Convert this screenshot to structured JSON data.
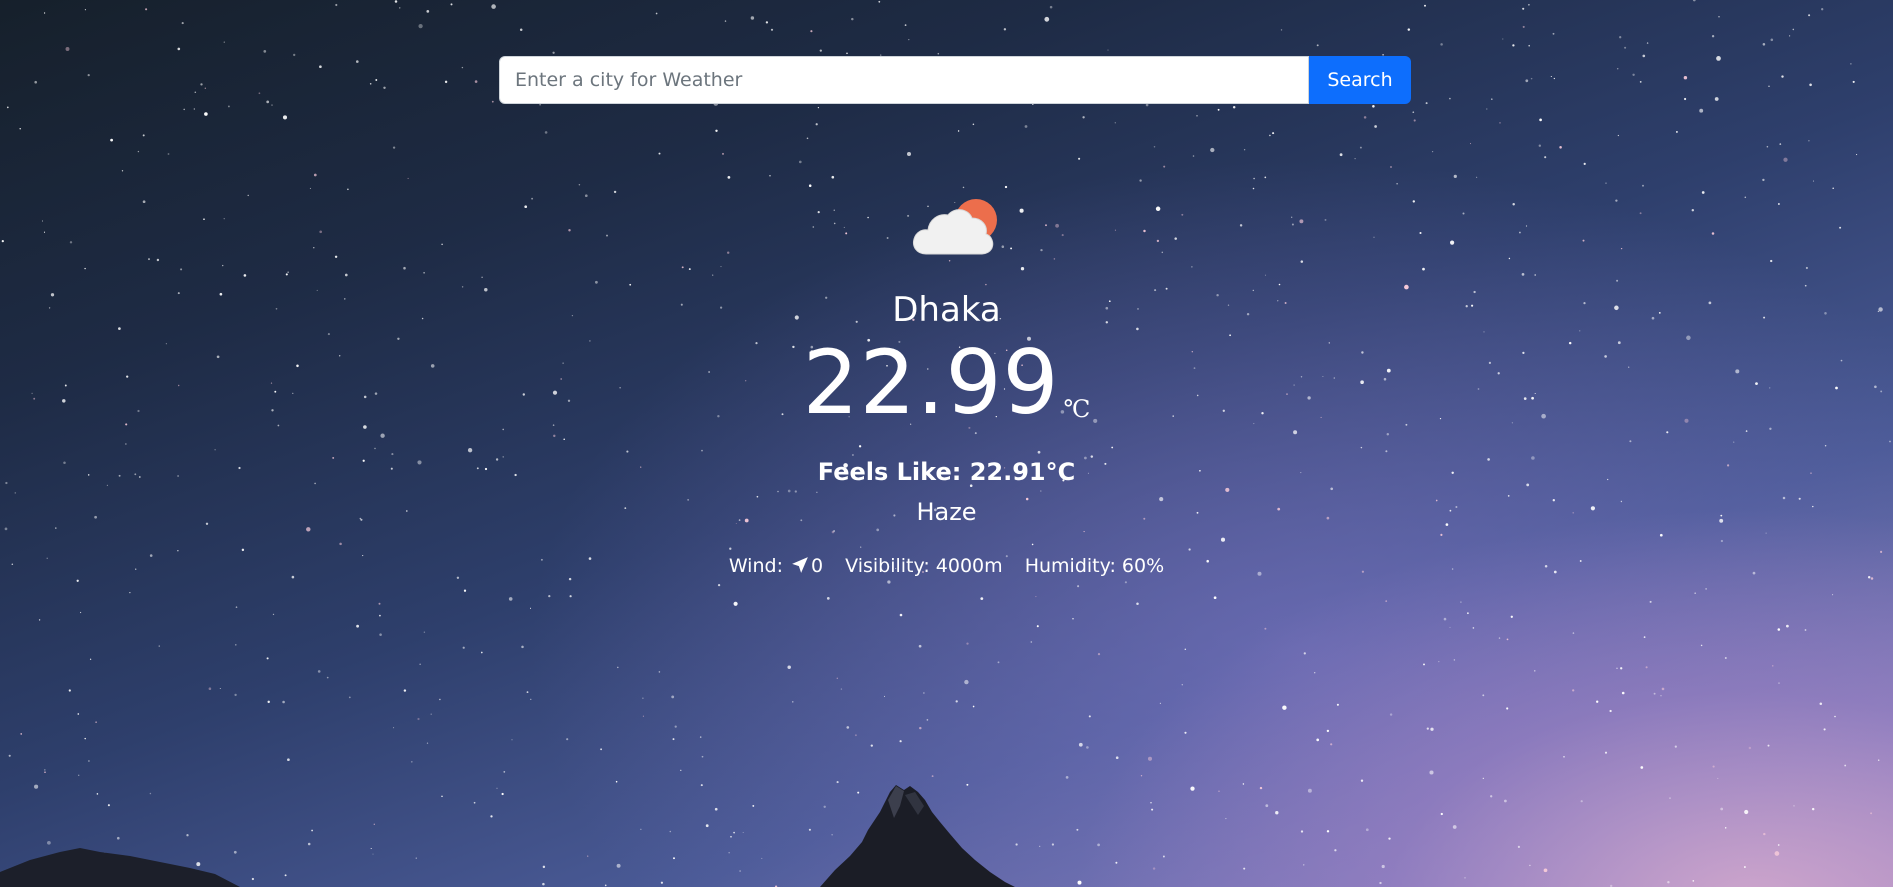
{
  "search": {
    "placeholder": "Enter a city for Weather",
    "value": "",
    "button_label": "Search"
  },
  "weather": {
    "icon": "partly-cloudy-icon",
    "city": "Dhaka",
    "temperature": "22.99",
    "unit": "℃",
    "feels_like": "Feels Like: 22.91°C",
    "condition": "Haze",
    "wind_label": "Wind:",
    "wind_value": "0",
    "visibility": "Visibility: 4000m",
    "humidity": "Humidity: 60%"
  },
  "colors": {
    "search_button": "#0d6efd",
    "sun": "#ec6e4c",
    "cloud": "#f1f1f1",
    "text": "#ffffff"
  }
}
